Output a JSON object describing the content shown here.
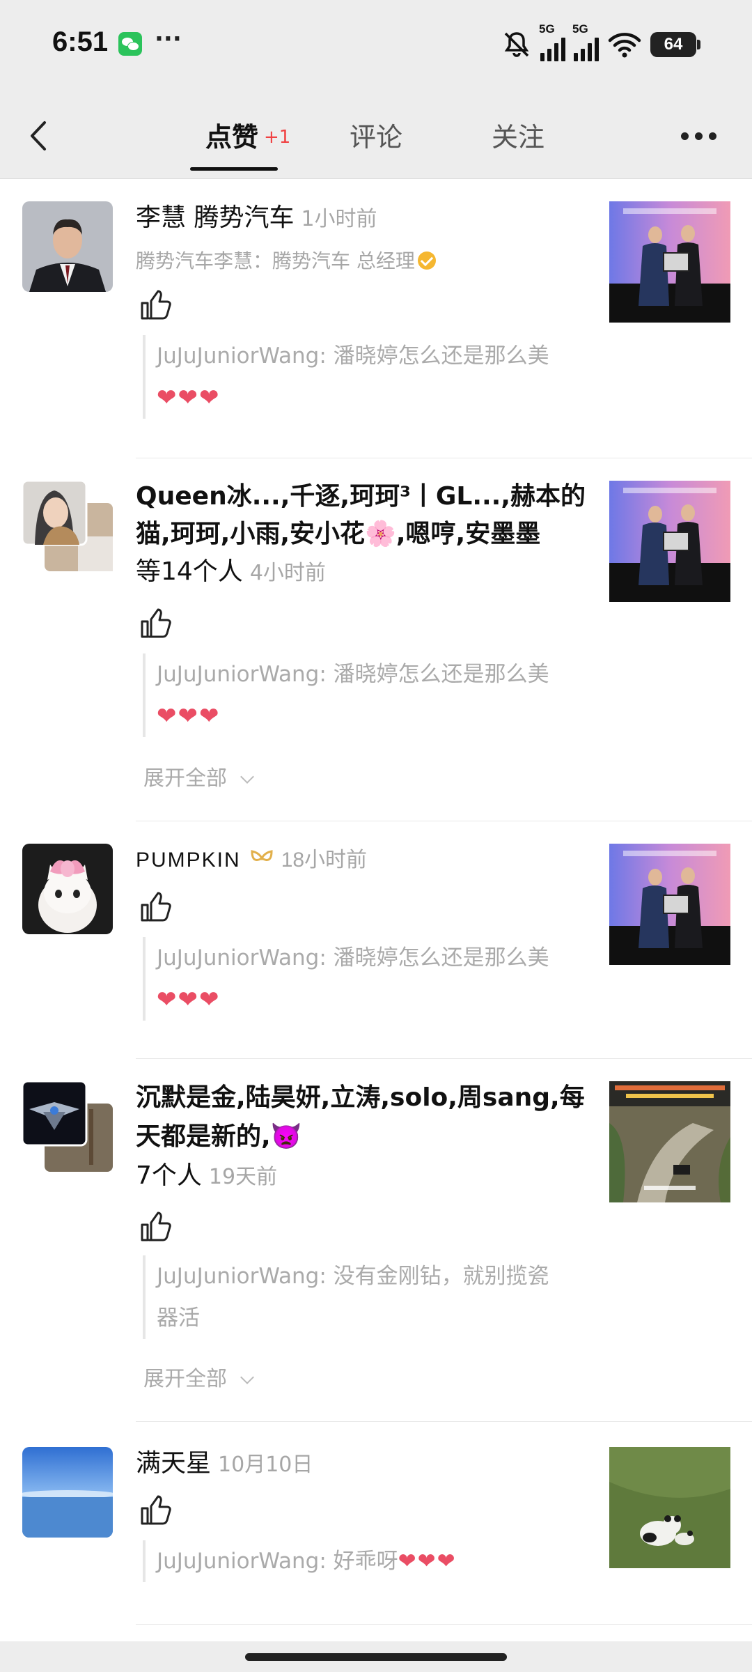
{
  "status_bar": {
    "time": "6:51",
    "dots": "···",
    "net1": "5G",
    "net2": "5G",
    "battery": "64"
  },
  "tabs": [
    {
      "label": "点赞",
      "badge": "+1"
    },
    {
      "label": "评论"
    },
    {
      "label": "关注"
    }
  ],
  "items": [
    {
      "name": "李慧 腾势汽车",
      "time": "1小时前",
      "subtitle": "腾势汽车李慧：腾势汽车 总经理",
      "quote": "JuJuJuniorWang: 潘晓婷怎么还是那么美",
      "hearts": "❤❤❤"
    },
    {
      "name_line1": "Queen冰...,千逐,珂珂³丨GL...,赫本的",
      "name_line2": "猫,珂珂,小雨,安小花🌸,嗯哼,安墨墨",
      "count": "等14个人",
      "time": "4小时前",
      "quote": "JuJuJuniorWang: 潘晓婷怎么还是那么美",
      "hearts": "❤❤❤",
      "expand": "展开全部"
    },
    {
      "name": "PUMPKIN",
      "time": "18小时前",
      "quote": "JuJuJuniorWang: 潘晓婷怎么还是那么美",
      "hearts": "❤❤❤"
    },
    {
      "name_line1": "沉默是金,陆昊妍,立涛,solo,周sang,每",
      "name_line2": "天都是新的,👿",
      "count": "7个人",
      "time": "19天前",
      "quote_line1": "JuJuJuniorWang: 没有金刚钻，就别揽瓷",
      "quote_line2": "器活",
      "expand": "展开全部"
    },
    {
      "name": "满天星",
      "time": "10月10日",
      "quote": "JuJuJuniorWang: 好乖呀",
      "hearts": "❤❤❤"
    }
  ]
}
